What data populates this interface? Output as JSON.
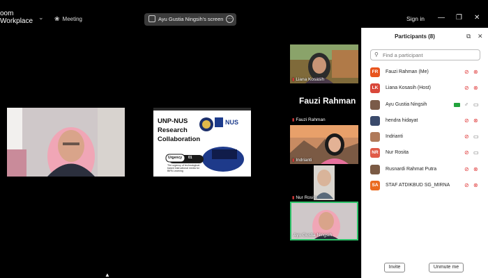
{
  "app": {
    "logo_line1": "oom",
    "logo_line2": "Workplace",
    "meeting_label": "Meeting",
    "share_pill": "Ayu Gustia Ningsih's screen",
    "signin": "Sign in"
  },
  "gallery": [
    {
      "name": "Liana Kosasih"
    },
    {
      "name": "Fauzi Rahman",
      "big_name": "Fauzi Rahman"
    },
    {
      "name": "Indrianti"
    },
    {
      "name": "Nur Rosita"
    },
    {
      "name": "Ayu Gustia Ningsih"
    }
  ],
  "slide": {
    "title_l1": "UNP-NUS",
    "title_l2": "Research",
    "title_l3": "Collaboration",
    "badge_word": "Urgency",
    "badge_num": "01",
    "caption": "The urgency of technological-based instructional media for BIPA Learning",
    "nus": "NUS"
  },
  "panel": {
    "title": "Participants (8)",
    "search_placeholder": "Find a participant",
    "participants": [
      {
        "initials": "FR",
        "name": "Fauzi Rahman (Me)",
        "color": "#e8541e",
        "mic": "muted",
        "cam": "off"
      },
      {
        "initials": "LK",
        "name": "Liana Kosasih (Host)",
        "color": "#d9473a",
        "mic": "muted",
        "cam": "off"
      },
      {
        "initials": "",
        "name": "Ayu Gustia Ningsih",
        "color": "#7a5b49",
        "mic": "on",
        "cam": "on",
        "sharing": true
      },
      {
        "initials": "",
        "name": "hendra hidayat",
        "color": "#3a4a6b",
        "mic": "muted",
        "cam": "off"
      },
      {
        "initials": "",
        "name": "Indrianti",
        "color": "#b07a5a",
        "mic": "muted",
        "cam": "on"
      },
      {
        "initials": "NR",
        "name": "Nur Rosita",
        "color": "#e05a47",
        "mic": "muted",
        "cam": "on"
      },
      {
        "initials": "",
        "name": "Rusnardi Rahmat Putra",
        "color": "#7b5a44",
        "mic": "muted",
        "cam": "off"
      },
      {
        "initials": "SA",
        "name": "STAF ATDIKBUD SG_MIRNA",
        "color": "#ea6a1f",
        "mic": "muted",
        "cam": "off"
      }
    ],
    "invite_label": "Invite",
    "unmute_label": "Unmute me"
  }
}
